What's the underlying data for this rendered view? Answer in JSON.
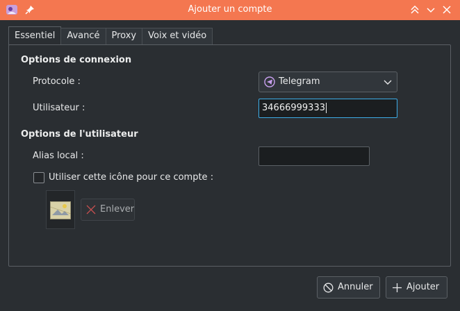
{
  "window": {
    "title": "Ajouter un compte",
    "accent": "#f47750"
  },
  "tabs": [
    {
      "label": "Essentiel"
    },
    {
      "label": "Avancé"
    },
    {
      "label": "Proxy"
    },
    {
      "label": "Voix et vidéo"
    }
  ],
  "connection": {
    "section_title": "Options de connexion",
    "protocol_label": "Protocole :",
    "protocol_value": "Telegram",
    "username_label": "Utilisateur :",
    "username_value": "34666999333"
  },
  "user_options": {
    "section_title": "Options de l'utilisateur",
    "alias_label": "Alias local :",
    "alias_value": "",
    "use_icon_label": "Utiliser cette icône pour ce compte :",
    "remove_label": "Enlever"
  },
  "footer": {
    "cancel_label": "Annuler",
    "add_label": "Ajouter"
  }
}
